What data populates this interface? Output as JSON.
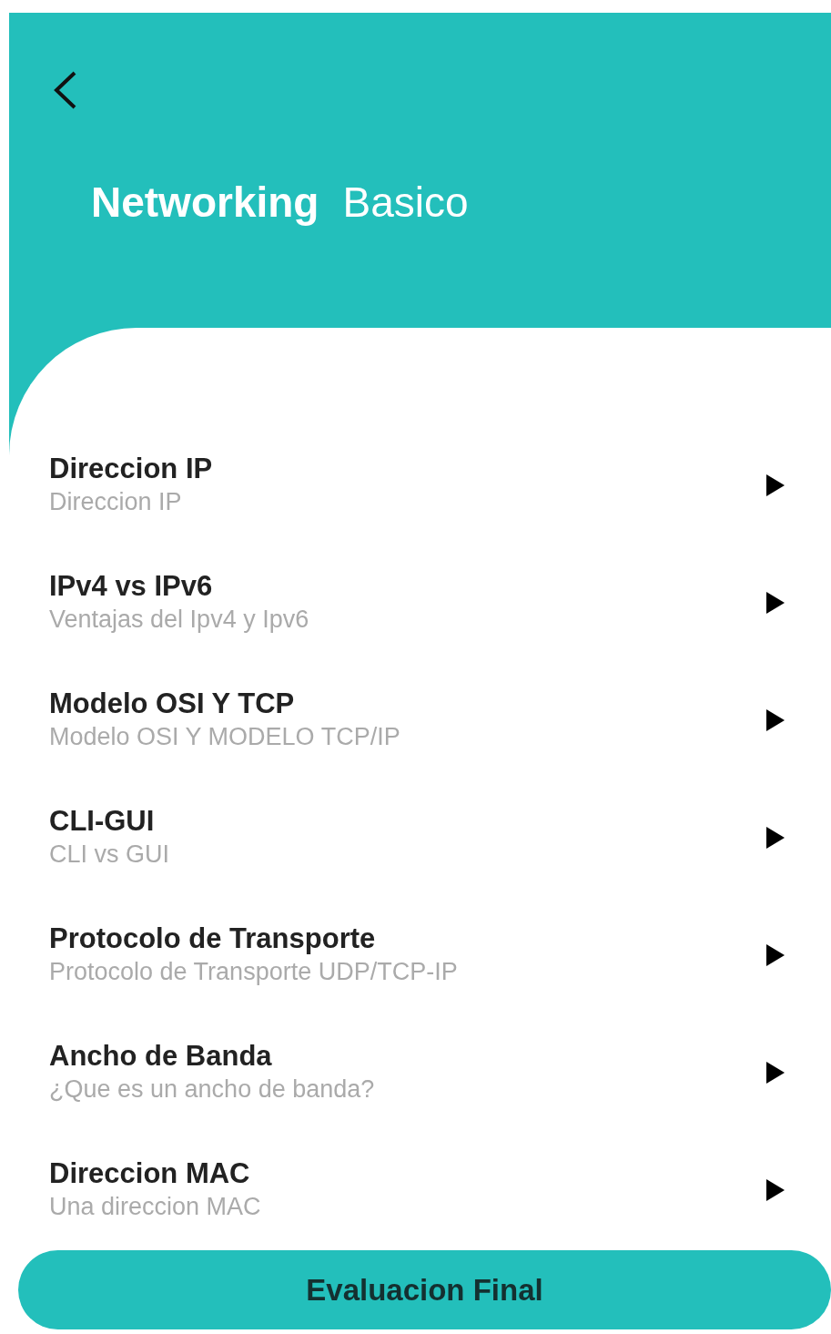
{
  "header": {
    "title_bold": "Networking",
    "title_regular": "Basico"
  },
  "topics": [
    {
      "title": "Direccion IP",
      "subtitle": "Direccion IP"
    },
    {
      "title": "IPv4 vs IPv6",
      "subtitle": "Ventajas del Ipv4 y Ipv6"
    },
    {
      "title": "Modelo OSI Y TCP",
      "subtitle": "Modelo OSI Y MODELO TCP/IP"
    },
    {
      "title": "CLI-GUI",
      "subtitle": "CLI vs GUI"
    },
    {
      "title": "Protocolo de Transporte",
      "subtitle": "Protocolo de Transporte UDP/TCP-IP"
    },
    {
      "title": "Ancho de Banda",
      "subtitle": "¿Que es un ancho de banda?"
    },
    {
      "title": "Direccion MAC",
      "subtitle": "Una direccion MAC"
    }
  ],
  "final_button": "Evaluacion Final"
}
